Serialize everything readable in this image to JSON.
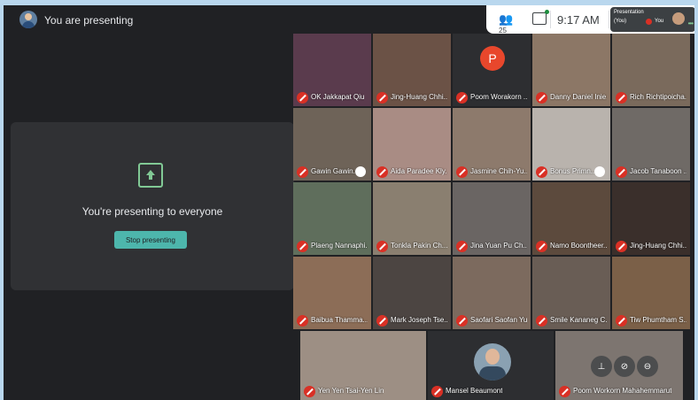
{
  "header": {
    "title": "You are presenting"
  },
  "toolbar": {
    "participant_count": "25",
    "time": "9:17 AM",
    "self_view": {
      "label": "Presentation",
      "sub": "(You)",
      "you": "You"
    }
  },
  "presentation": {
    "message": "You're presenting to everyone",
    "stop_label": "Stop presenting"
  },
  "participants": {
    "r0": [
      "OK Jakkapat Qiu",
      "Jing-Huang Chhi...",
      "Poom Worakorn ...",
      "Danny Daniel Inie...",
      "Rich Richtipoicha..."
    ],
    "r1": [
      "Gawin Gawin...",
      "Aida Paradee Kly...",
      "Jasmine Chih-Yu...",
      "Bonus Primn...",
      "Jacob Tanaboon ..."
    ],
    "r2": [
      "Plaeng Nannaphi...",
      "Tonkla Pakin Ch...",
      "Jina Yuan Pu Ch...",
      "Namo Boontheer...",
      "Jing-Huang Chhi..."
    ],
    "r3": [
      "Baibua Thamma...",
      "Mark Joseph Tse...",
      "Saofari Saofan Yu",
      "Smile Kananeg C...",
      "Tiw Phumtham S..."
    ],
    "r4": [
      "Yen Yen Tsai-Yen Lin",
      "Mansel Beaumont",
      "Poom Workorn Mahahemmarut"
    ]
  },
  "avatar_letter": "P",
  "colors": {
    "accent": "#4db6ac",
    "mic_off": "#d93025",
    "background": "#202124"
  }
}
